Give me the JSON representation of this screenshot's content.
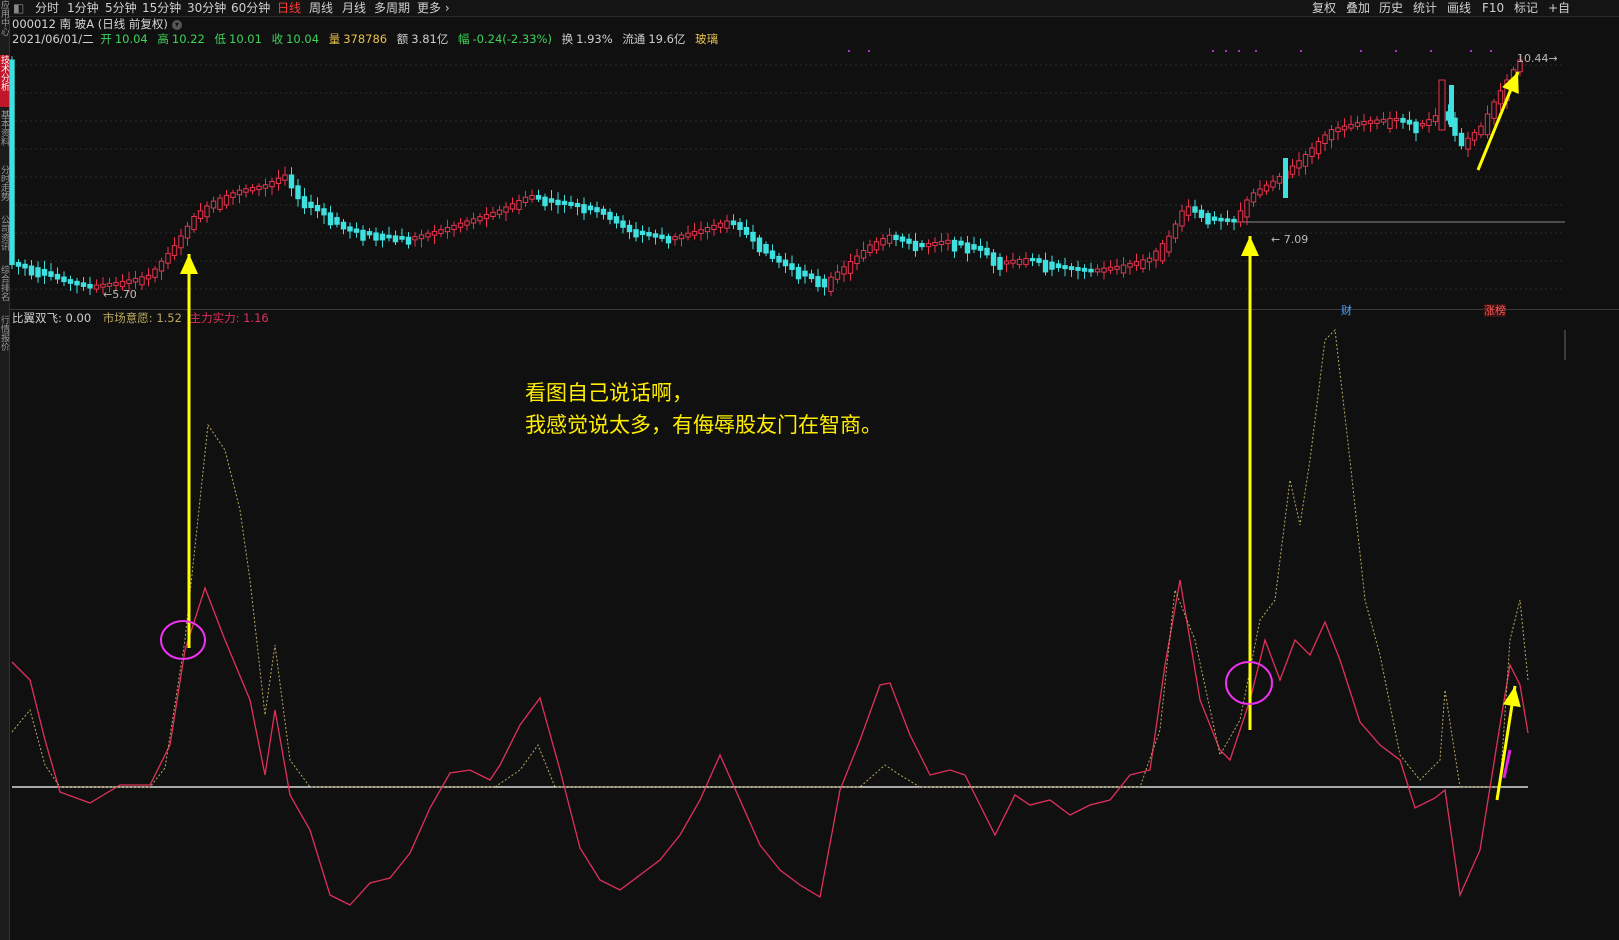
{
  "toolbar": {
    "left_items": [
      "分时",
      "1分钟",
      "5分钟",
      "15分钟",
      "30分钟",
      "60分钟",
      "日线",
      "周线",
      "月线",
      "多周期",
      "更多"
    ],
    "active_period": "日线",
    "right_items": [
      "复权",
      "叠加",
      "历史",
      "统计",
      "画线",
      "F10",
      "标记",
      "+自"
    ]
  },
  "sidebar": {
    "tabs": [
      "应用中心",
      "技术分析",
      "基本资料",
      "分时走势",
      "公司资讯",
      "综合排名",
      "行情报价"
    ],
    "active_tab": "技术分析"
  },
  "stock": {
    "title": "000012 南 玻A (日线 前复权)"
  },
  "quote": {
    "date": "2021/06/01/二",
    "open_label": "开",
    "open": "10.04",
    "high_label": "高",
    "high": "10.22",
    "low_label": "低",
    "low": "10.01",
    "close_label": "收",
    "close": "10.04",
    "volume_label": "量",
    "volume": "378786",
    "amount_label": "额",
    "amount": "3.81亿",
    "change_label": "幅",
    "change": "-0.24(-2.33%)",
    "turnover_label": "换",
    "turnover": "1.93%",
    "float_label": "流通",
    "float": "19.6亿",
    "sector": "玻璃"
  },
  "price_labels": {
    "low_marker": "5.70",
    "mid_marker": "7.09",
    "high_marker": "10.44"
  },
  "event_badges": [
    {
      "text": "财",
      "color": "#4aa3ff"
    },
    {
      "text": "涨榜",
      "color": "#ff5a5a"
    }
  ],
  "indicator": {
    "name": "比翼双飞",
    "value": ": 0.00",
    "line1_name": "市场意愿",
    "line1_value": "1.52",
    "line2_name": "主力实力",
    "line2_value": "1.16"
  },
  "annotation": {
    "line1": "看图自己说话啊，",
    "line2": "我感觉说太多，有侮辱股友门在智商。"
  },
  "colors": {
    "up": "#e8344e",
    "down": "#3fe0e0",
    "arrow": "#ffff00",
    "circle": "#ee33ee",
    "line_market": "#b8a860",
    "line_power": "#e0305a"
  }
}
